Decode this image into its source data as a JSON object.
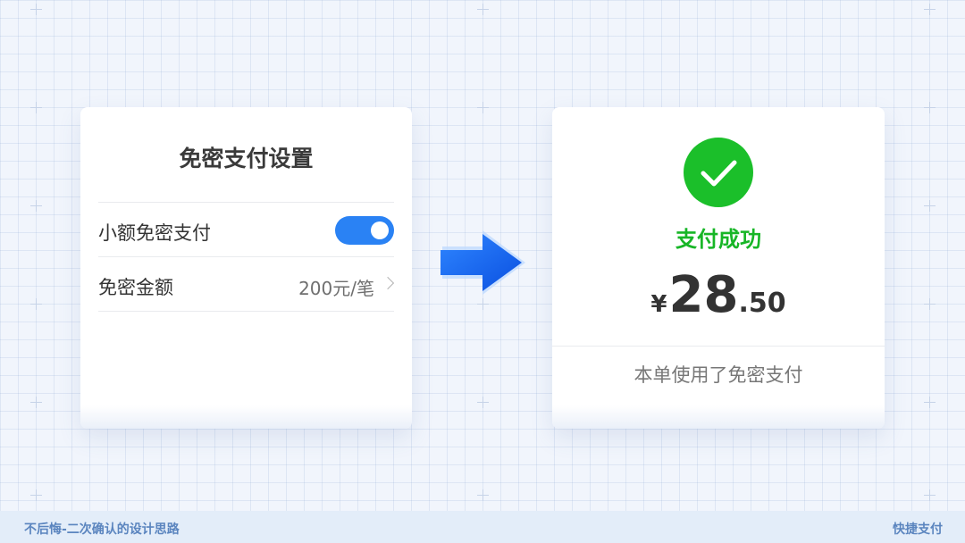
{
  "settings_card": {
    "title": "免密支付设置",
    "rows": [
      {
        "label": "小额免密支付",
        "toggle_on": true
      },
      {
        "label": "免密金额",
        "value": "200元/笔"
      }
    ]
  },
  "transition_icon": "arrow-right-icon",
  "result_card": {
    "icon": "check-circle-icon",
    "title": "支付成功",
    "amount": {
      "currency": "¥",
      "integer": "28",
      "decimal": ".50"
    },
    "note": "本单使用了免密支付"
  },
  "footer": {
    "left_text": "不后悔-二次确认的设计思路",
    "right_text": "快捷支付"
  },
  "colors": {
    "toggle_on": "#2a82f4",
    "success": "#1bbf2a",
    "arrow": "#1a6ff5",
    "footer_text": "#5b85bf"
  }
}
